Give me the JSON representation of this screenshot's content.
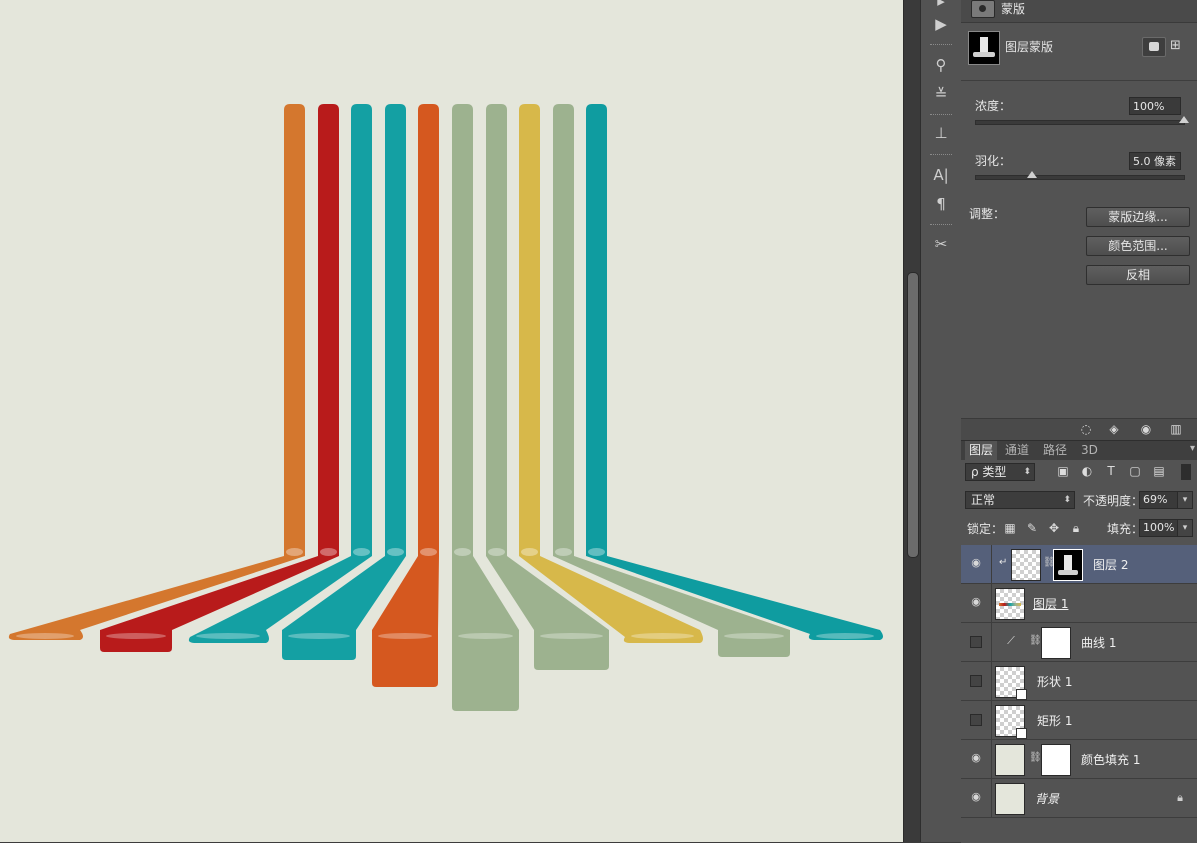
{
  "canvas": {
    "background_color": "#e4e6db",
    "stripe_colors": [
      "#d4772e",
      "#b81b1b",
      "#14a0a3",
      "#14a0a3",
      "#d5581f",
      "#9db28f",
      "#9db28f",
      "#d7b84a",
      "#9db28f",
      "#0f9ca0"
    ]
  },
  "toolstrip": {
    "icons": [
      "play-icon",
      "brush-preset-icon",
      "brush-settings-icon",
      "clone-source-icon",
      "character-icon",
      "paragraph-icon",
      "tool-presets-icon"
    ]
  },
  "properties": {
    "header_title": "蒙版",
    "mask_label": "图层蒙版",
    "density_label": "浓度：",
    "density_value": "100%",
    "density_level": 1.0,
    "feather_label": "羽化：",
    "feather_value": "5.0 像素",
    "feather_level": 0.27,
    "adjust_label": "调整：",
    "btn_mask_edge": "蒙版边缘...",
    "btn_color_range": "颜色范围...",
    "btn_invert": "反相"
  },
  "layers_panel": {
    "tabs": [
      "图层",
      "通道",
      "路径",
      "3D"
    ],
    "filter_type": "ρ 类型",
    "blend_mode": "正常",
    "opacity_label": "不透明度：",
    "opacity_value": "69%",
    "lock_label": "锁定：",
    "fill_label": "填充：",
    "fill_value": "100%",
    "layers": [
      {
        "name": "图层 2",
        "visible": true,
        "selected": true
      },
      {
        "name": "图层 1",
        "visible": true,
        "selected": false
      },
      {
        "name": "曲线 1",
        "visible": false,
        "selected": false
      },
      {
        "name": "形状 1",
        "visible": false,
        "selected": false
      },
      {
        "name": "矩形 1",
        "visible": false,
        "selected": false
      },
      {
        "name": "颜色填充 1",
        "visible": true,
        "selected": false
      },
      {
        "name": "背景",
        "visible": true,
        "selected": false
      }
    ]
  }
}
